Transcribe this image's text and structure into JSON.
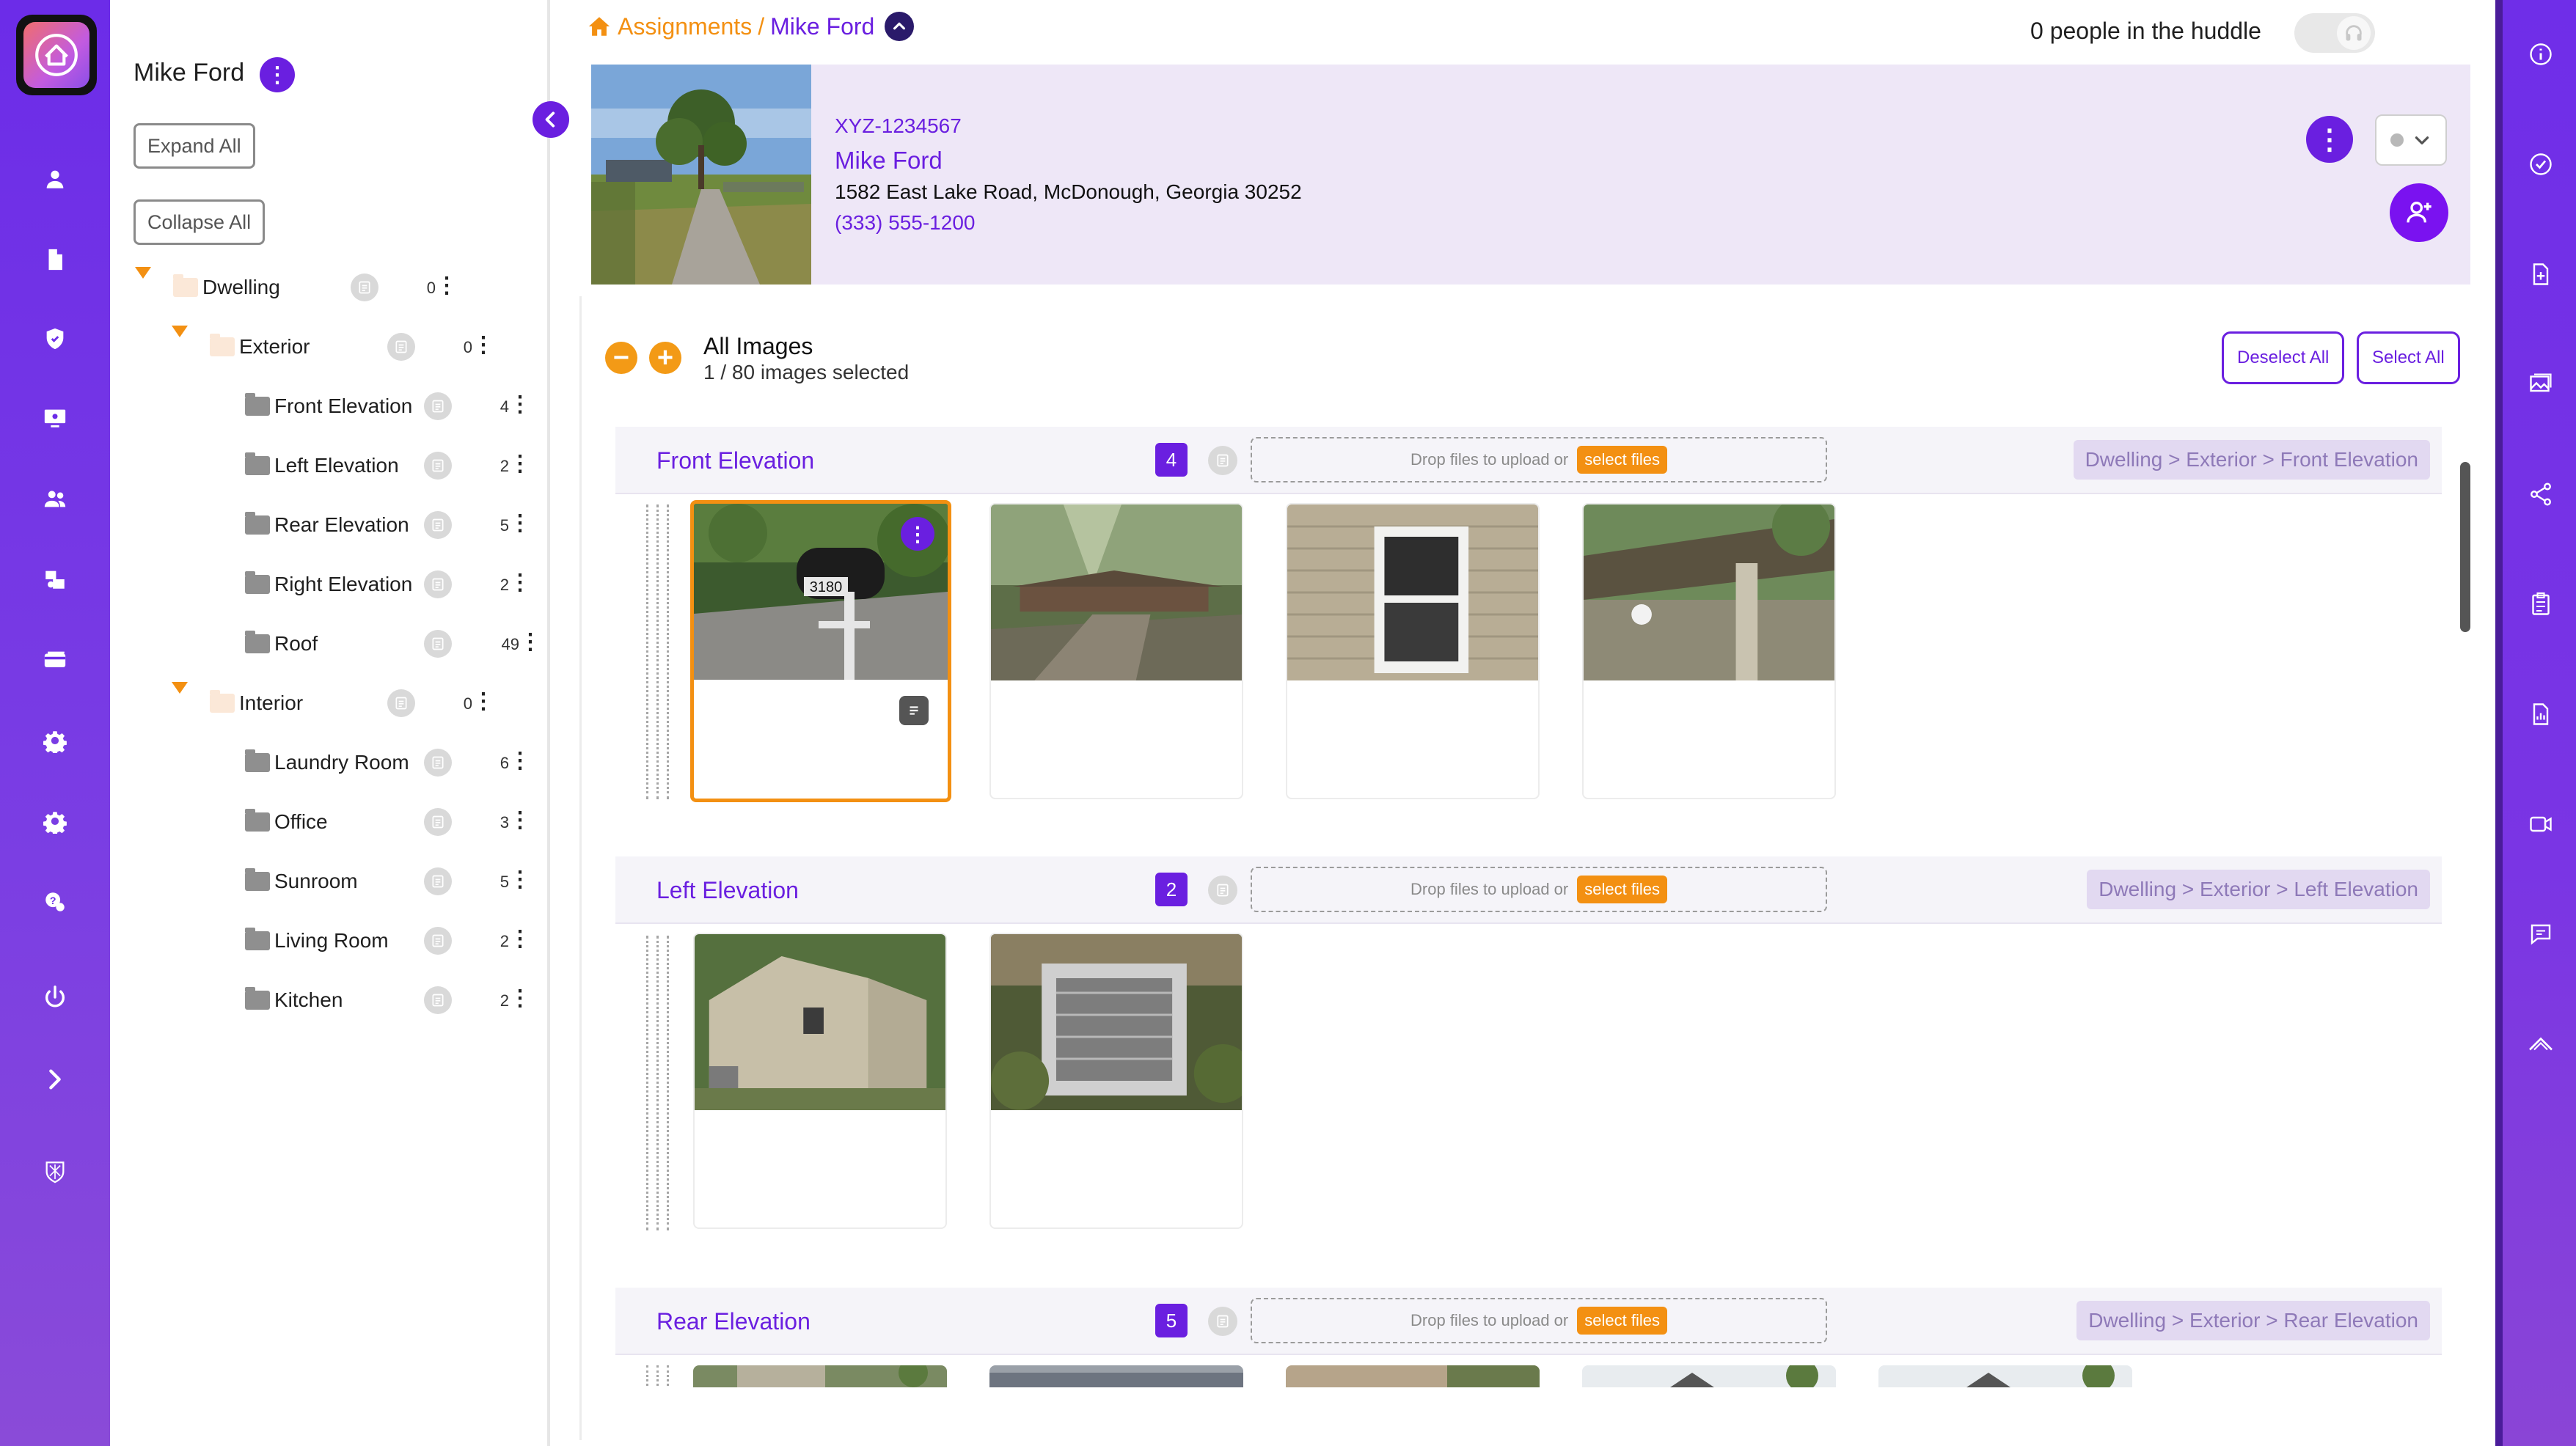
{
  "sidebar": {
    "items": [
      {
        "icon": "user-icon"
      },
      {
        "icon": "document-icon"
      },
      {
        "icon": "shield-icon"
      },
      {
        "icon": "monitor-icon"
      },
      {
        "icon": "users-icon"
      },
      {
        "icon": "boxes-icon"
      },
      {
        "icon": "card-icon"
      },
      {
        "icon": "gear-icon"
      },
      {
        "icon": "gear-icon"
      },
      {
        "icon": "support-icon"
      },
      {
        "icon": "power-icon"
      },
      {
        "icon": "chevron-right-icon"
      },
      {
        "icon": "brand-crest-icon"
      }
    ]
  },
  "tree": {
    "user_name": "Mike Ford",
    "expand_all": "Expand All",
    "collapse_all": "Collapse All",
    "nodes": [
      {
        "label": "Dwelling",
        "count": "0"
      },
      {
        "label": "Exterior",
        "count": "0"
      },
      {
        "label": "Front Elevation",
        "count": "4"
      },
      {
        "label": "Left Elevation",
        "count": "2"
      },
      {
        "label": "Rear Elevation",
        "count": "5"
      },
      {
        "label": "Right Elevation",
        "count": "2"
      },
      {
        "label": "Roof",
        "count": "49"
      },
      {
        "label": "Interior",
        "count": "0"
      },
      {
        "label": "Laundry Room",
        "count": "6"
      },
      {
        "label": "Office",
        "count": "3"
      },
      {
        "label": "Sunroom",
        "count": "5"
      },
      {
        "label": "Living Room",
        "count": "2"
      },
      {
        "label": "Kitchen",
        "count": "2"
      }
    ]
  },
  "breadcrumb": {
    "parent": "Assignments",
    "separator": "/",
    "current": "Mike Ford"
  },
  "huddle": {
    "text": "0 people in the huddle"
  },
  "header": {
    "id": "XYZ-1234567",
    "name": "Mike Ford",
    "address": "1582 East Lake Road, McDonough, Georgia 30252",
    "phone": "(333) 555-1200"
  },
  "images": {
    "title": "All Images",
    "selection": "1 / 80 images selected",
    "deselect_all": "Deselect All",
    "select_all": "Select All",
    "drop_text": "Drop files to upload or",
    "select_files": "select files",
    "groups": [
      {
        "title": "Front Elevation",
        "count": "4",
        "path": "Dwelling > Exterior > Front Elevation"
      },
      {
        "title": "Left Elevation",
        "count": "2",
        "path": "Dwelling > Exterior > Left Elevation"
      },
      {
        "title": "Rear Elevation",
        "count": "5",
        "path": "Dwelling > Exterior > Rear Elevation"
      }
    ]
  },
  "right_rail": {
    "items": [
      {
        "icon": "info-icon"
      },
      {
        "icon": "check-circle-icon"
      },
      {
        "icon": "add-file-icon"
      },
      {
        "icon": "gallery-icon"
      },
      {
        "icon": "share-icon"
      },
      {
        "icon": "clipboard-icon"
      },
      {
        "icon": "report-icon"
      },
      {
        "icon": "video-icon"
      },
      {
        "icon": "chat-icon"
      },
      {
        "icon": "roof-icon"
      }
    ]
  },
  "colors": {
    "brand_purple": "#6a1fe0",
    "accent_orange": "#f39012",
    "header_bg": "#eee7f7"
  }
}
